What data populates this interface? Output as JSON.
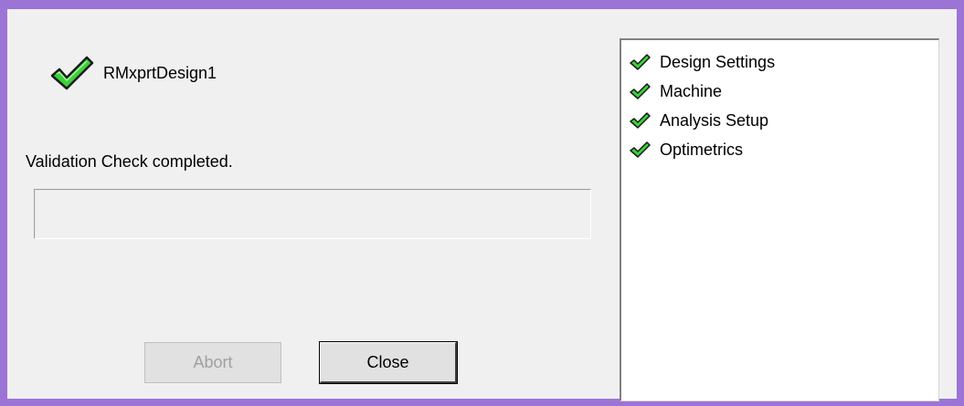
{
  "design": {
    "name": "RMxprtDesign1",
    "icon": "checkmark-icon"
  },
  "status": {
    "message": "Validation Check completed."
  },
  "buttons": {
    "abort_label": "Abort",
    "close_label": "Close"
  },
  "checklist": {
    "items": [
      {
        "label": "Design Settings",
        "icon": "checkmark-icon"
      },
      {
        "label": "Machine",
        "icon": "checkmark-icon"
      },
      {
        "label": "Analysis Setup",
        "icon": "checkmark-icon"
      },
      {
        "label": "Optimetrics",
        "icon": "checkmark-icon"
      }
    ]
  },
  "colors": {
    "title_bar": "#9c74d6",
    "check_green": "#3ad13a",
    "check_outline": "#1a1a1a"
  }
}
